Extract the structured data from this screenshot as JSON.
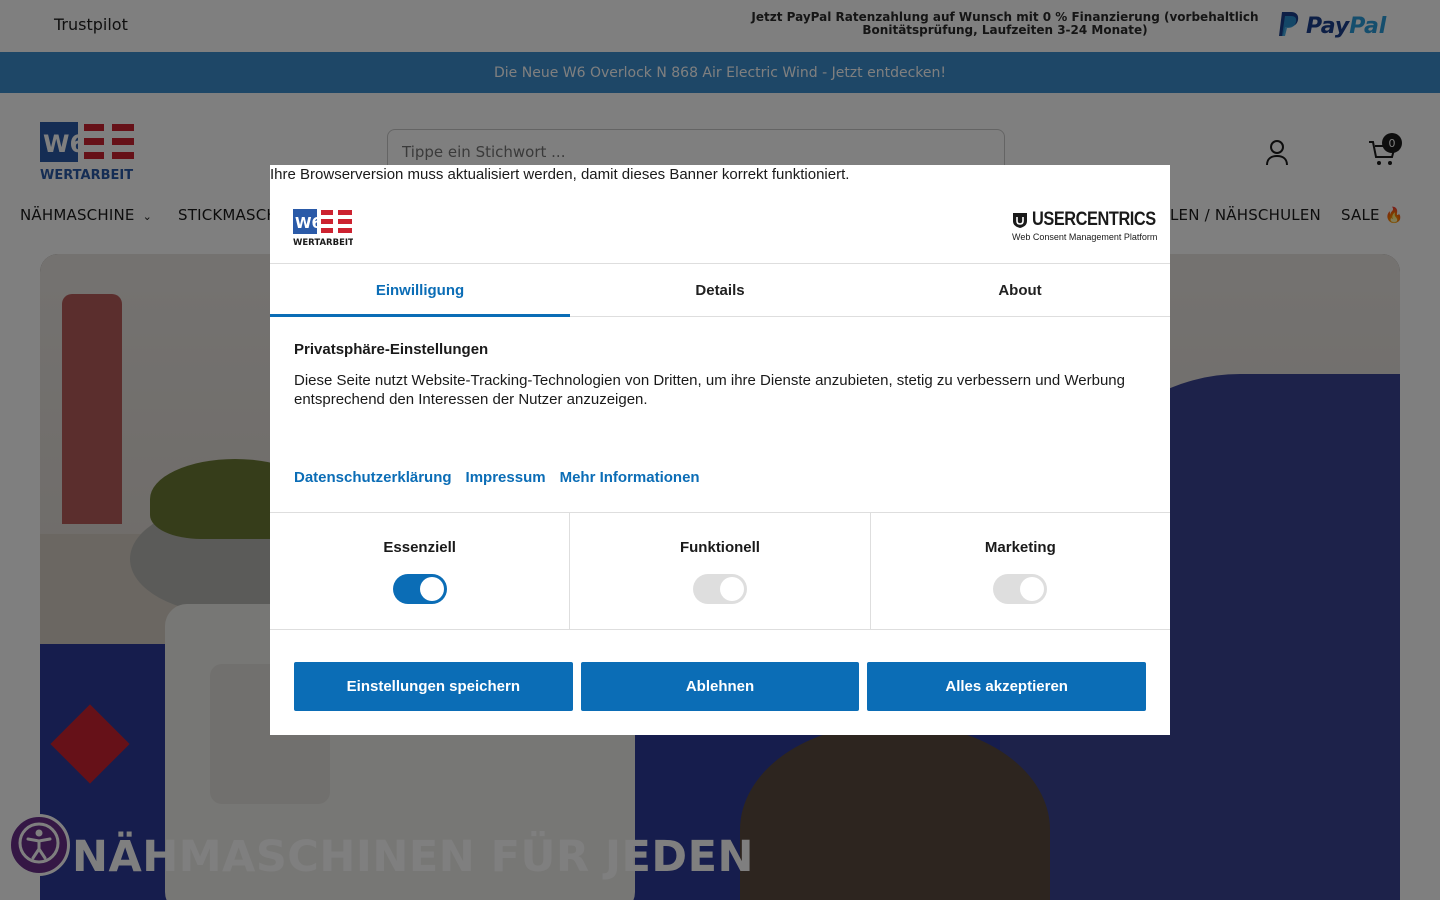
{
  "topbar": {
    "trustpilot": "Trustpilot",
    "paypal_note_normal": "Jetzt PayPal Ratenzahlung auf Wunsch mit 0 % Finanzierung",
    "paypal_note_bold": "(vorbehaltlich Bonitätsprüfung, Laufzeiten 3-24 Monate)",
    "paypal_logo_left": "Pay",
    "paypal_logo_right": "Pal"
  },
  "promo": {
    "text": "Die Neue W6 Overlock N 868 Air Electric Wind - Jetzt entdecken!"
  },
  "header": {
    "search_placeholder": "Tippe ein Stichwort ...",
    "cart_count": "0",
    "logo_text": "WERTARBEIT"
  },
  "nav": {
    "items": [
      {
        "label": "NÄHMASCHINE",
        "has_dropdown": true
      },
      {
        "label": "STICKMASCH"
      },
      {
        "label": "LEN / NÄHSCHULEN"
      },
      {
        "label": "SALE 🔥"
      }
    ]
  },
  "hero": {
    "title": "NÄHMASCHINEN FÜR JEDEN"
  },
  "consent": {
    "browser_warning": "Ihre Browserversion muss aktualisiert werden, damit dieses Banner korrekt funktioniert.",
    "uc_brand": "USERCENTRICS",
    "uc_subtitle": "Web Consent Management Platform",
    "dlg_logo_text": "WERTARBEIT",
    "tabs": [
      {
        "label": "Einwilligung",
        "active": true
      },
      {
        "label": "Details",
        "active": false
      },
      {
        "label": "About",
        "active": false
      }
    ],
    "title": "Privatsphäre-Einstellungen",
    "text": "Diese Seite nutzt Website-Tracking-Technologien von Dritten, um ihre Dienste anzubieten, stetig zu verbessern und Werbung entsprechend den Interessen der Nutzer anzuzeigen.",
    "links": [
      "Datenschutzerklärung",
      "Impressum",
      "Mehr Informationen"
    ],
    "categories": [
      {
        "label": "Essenziell",
        "enabled": true
      },
      {
        "label": "Funktionell",
        "enabled": false
      },
      {
        "label": "Marketing",
        "enabled": false
      }
    ],
    "buttons": {
      "save": "Einstellungen speichern",
      "deny": "Ablehnen",
      "accept": "Alles akzeptieren"
    }
  },
  "colors": {
    "accent_blue": "#0b6db6",
    "promo_bar": "#3c8fcf",
    "brand_red": "#cc2230",
    "accessibility_purple": "#6b2f8a"
  },
  "icons": [
    "account-icon",
    "cart-icon",
    "chevron-down-icon",
    "accessibility-icon",
    "shield-icon"
  ]
}
